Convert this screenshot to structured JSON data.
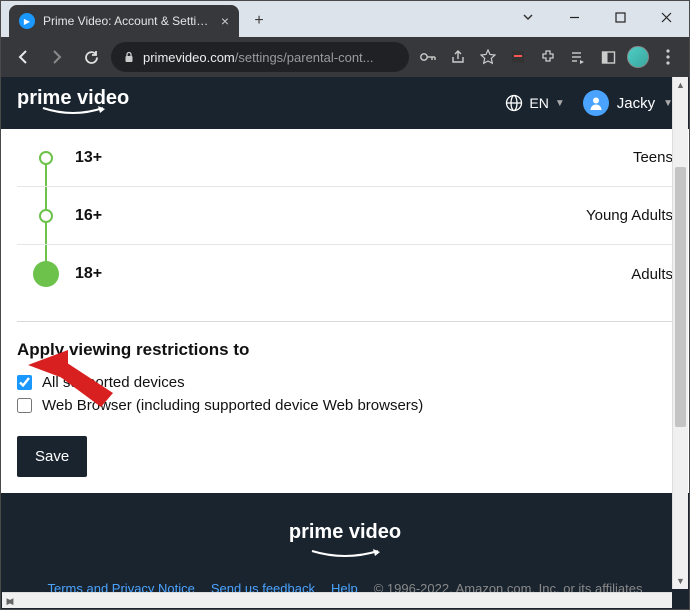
{
  "browser": {
    "tab_title": "Prime Video: Account & Settings",
    "url_domain": "primevideo.com",
    "url_path": "/settings/parental-cont..."
  },
  "header": {
    "logo_text": "prime video",
    "language": "EN",
    "user_name": "Jacky"
  },
  "ratings": [
    {
      "label": "13+",
      "desc": "Teens",
      "filled": false
    },
    {
      "label": "16+",
      "desc": "Young Adults",
      "filled": false
    },
    {
      "label": "18+",
      "desc": "Adults",
      "filled": true
    }
  ],
  "restrictions": {
    "title": "Apply viewing restrictions to",
    "options": [
      {
        "label": "All supported devices",
        "checked": true
      },
      {
        "label": "Web Browser (including supported device Web browsers)",
        "checked": false
      }
    ],
    "save_label": "Save"
  },
  "footer": {
    "logo_text": "prime video",
    "links": [
      "Terms and Privacy Notice",
      "Send us feedback",
      "Help"
    ],
    "copyright": "© 1996-2022, Amazon.com, Inc. or its affiliates"
  }
}
